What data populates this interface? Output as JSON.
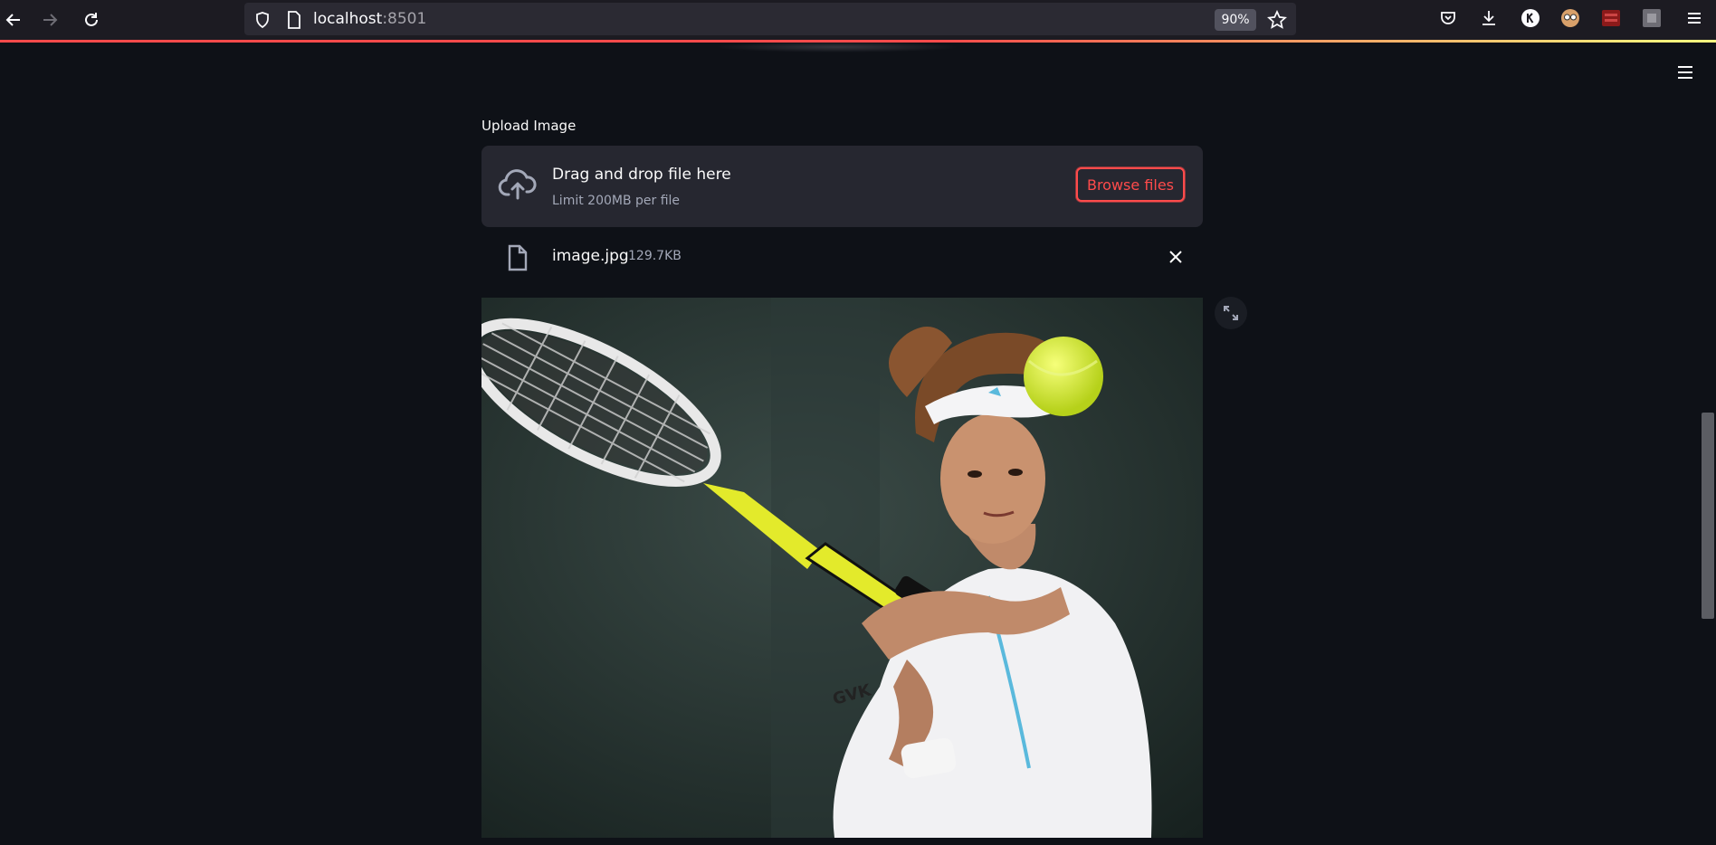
{
  "browser": {
    "url_host": "localhost",
    "url_port": ":8501",
    "zoom": "90%"
  },
  "uploader": {
    "label": "Upload Image",
    "dropzone_title": "Drag and drop file here",
    "dropzone_subtitle": "Limit 200MB per file",
    "browse_label": "Browse files"
  },
  "file": {
    "name": "image.jpg",
    "size": "129.7KB"
  },
  "colors": {
    "background": "#0e1117",
    "dropzone": "#262730",
    "accent": "#ff4b4b"
  }
}
